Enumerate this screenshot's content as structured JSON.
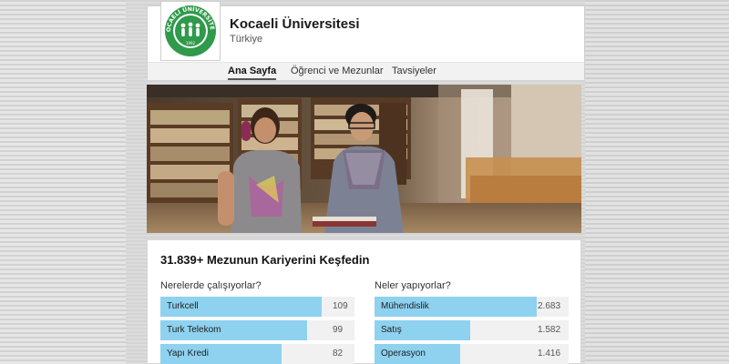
{
  "organization": {
    "name": "Kocaeli Üniversitesi",
    "country": "Türkiye",
    "logo_text_top": "KOCAELİ ÜNİVERSİTESİ",
    "logo_year": "1992"
  },
  "tabs": [
    {
      "label": "Ana Sayfa",
      "active": true
    },
    {
      "label": "Öğrenci ve Mezunlar",
      "active": false
    },
    {
      "label": "Tavsiyeler",
      "active": false
    }
  ],
  "section": {
    "title": "31.839+ Mezunun Kariyerini Keşfedin"
  },
  "where": {
    "title": "Nerelerde çalışıyorlar?",
    "items": [
      {
        "label": "Turkcell",
        "value": "109",
        "fraction": 1.0
      },
      {
        "label": "Turk Telekom",
        "value": "99",
        "fraction": 0.908
      },
      {
        "label": "Yapı Kredi",
        "value": "82",
        "fraction": 0.752
      }
    ]
  },
  "what": {
    "title": "Neler yapıyorlar?",
    "items": [
      {
        "label": "Mühendislik",
        "value": "2.683",
        "fraction": 1.0
      },
      {
        "label": "Satış",
        "value": "1.582",
        "fraction": 0.59
      },
      {
        "label": "Operasyon",
        "value": "1.416",
        "fraction": 0.528
      }
    ]
  },
  "colors": {
    "bar_fill": "#8ed2ef",
    "logo_green": "#2e9a4a"
  }
}
